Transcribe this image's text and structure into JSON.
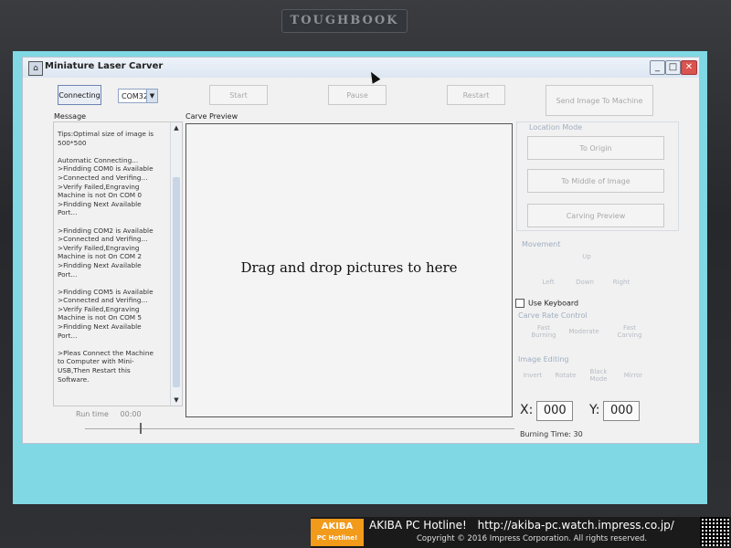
{
  "bezel": {
    "brand": "TOUGHBOOK"
  },
  "window": {
    "title": "Miniature Laser Carver",
    "controls": {
      "minimize": "_",
      "maximize": "□",
      "close": "✕"
    }
  },
  "toolbar": {
    "connect_label": "Connecting",
    "port_value": "COM32",
    "start_label": "Start",
    "pause_label": "Pause",
    "restart_label": "Restart",
    "send_label": "Send Image To Machine"
  },
  "message_panel": {
    "title": "Message",
    "lines": [
      "Tips:Optimal size of image is",
      "500*500",
      "",
      "Automatic Connecting...",
      " >Findding COM0 is Available",
      " >Connected and Verifing...",
      " >Verify Failed,Engraving",
      " Machine is not On COM 0",
      " >Findding Next Available",
      " Port...",
      "",
      "  >Findding COM2 is Available",
      "  >Connected and Verifing...",
      "  >Verify Failed,Engraving",
      "  Machine is not On COM 2",
      "  >Findding Next Available",
      "  Port...",
      "",
      "   >Findding COM5 is Available",
      "   >Connected and Verifing...",
      "   >Verify Failed,Engraving",
      "   Machine is not On COM 5",
      "   >Findding Next Available",
      "   Port...",
      "",
      "   >Pleas Connect the Machine",
      "   to Computer with Mini-",
      "   USB,Then Restart this",
      "   Software."
    ],
    "runtime_label": "Run time",
    "runtime_value": "00:00"
  },
  "preview": {
    "title": "Carve Preview",
    "drop_message": "Drag and drop pictures to here"
  },
  "location_mode": {
    "title": "Location Mode",
    "to_origin": "To Origin",
    "to_middle": "To Middle of Image",
    "carving_preview": "Carving Preview"
  },
  "movement": {
    "title": "Movement",
    "up": "Up",
    "left": "Left",
    "down": "Down",
    "right": "Right"
  },
  "keyboard": {
    "label": "Use Keyboard"
  },
  "carve_rate": {
    "title": "Carve Rate Control",
    "faster": "Fast Burning",
    "medium": "Moderate",
    "slower": "Fast Carving"
  },
  "image_editing": {
    "title": "Image Editing",
    "items": [
      "Invert",
      "Rotate",
      "Black Mode",
      "Mirror"
    ]
  },
  "coordinates": {
    "x_label": "X:",
    "x_value": "000",
    "y_label": "Y:",
    "y_value": "000"
  },
  "burning": {
    "label": "Burning Time:",
    "value": "30"
  },
  "watermark": {
    "logo_line1": "AKIBA",
    "logo_line2": "PC Hotline!",
    "site_name": "AKIBA PC Hotline!",
    "url": "http://akiba-pc.watch.impress.co.jp/",
    "copyright": "Copyright © 2016 Impress Corporation. All rights reserved."
  }
}
